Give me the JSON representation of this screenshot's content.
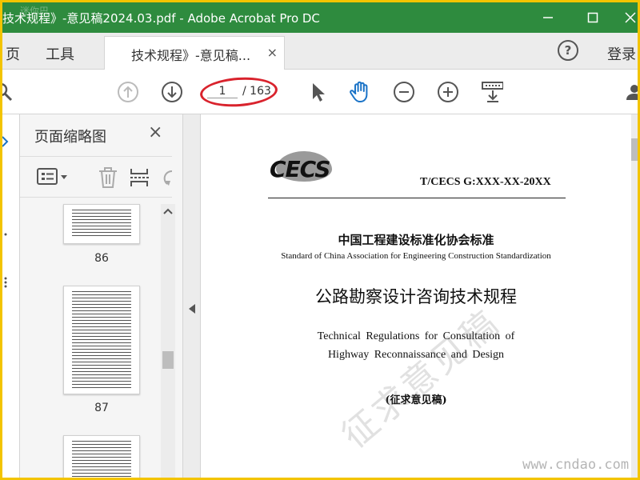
{
  "window": {
    "title": "技术规程》-意见稿2024.03.pdf - Adobe Acrobat Pro DC",
    "watermark": "迷你巴"
  },
  "tabbar": {
    "nav_home_partial": "页",
    "nav_tools": "工具",
    "doc_tab_label": "技术规程》-意见稿...",
    "doc_tab_close": "×",
    "help": "?",
    "login": "登录"
  },
  "toolbar": {
    "current_page": "1",
    "total_pages": "/ 163"
  },
  "thumbnails": {
    "panel_title": "页面缩略图",
    "close": "×",
    "pages": [
      "86",
      "87"
    ]
  },
  "document": {
    "logo_text": "CECS",
    "standard_code": "T/CECS G:XXX-XX-20XX",
    "org_cn": "中国工程建设标准化协会标准",
    "org_en": "Standard of China Association for Engineering Construction Standardization",
    "title_cn": "公路勘察设计咨询技术规程",
    "title_en_line1": "Technical Regulations for Consultation of",
    "title_en_line2": "Highway Reconnaissance and Design",
    "draft_label": "(征求意见稿)",
    "watermark_text": "征求意见稿",
    "site_watermark": "www.cndao.com"
  },
  "colors": {
    "title_bar": "#2e8b3e",
    "outer_border": "#f3c400",
    "annotation_ring": "#d9232d",
    "accent_icon": "#1a73c7"
  }
}
